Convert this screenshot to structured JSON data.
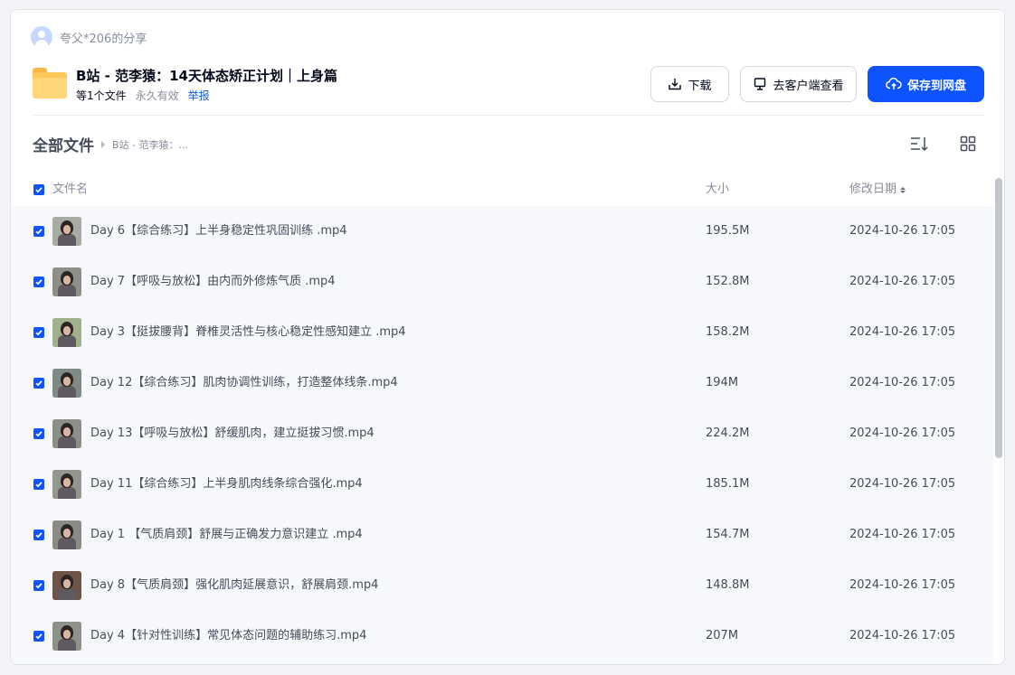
{
  "sharer": {
    "name": "夸父*206的分享"
  },
  "share": {
    "title": "B站 - 范李猿：14天体态矫正计划｜上身篇",
    "file_count": "等1个文件",
    "validity": "永久有效",
    "report_label": "举报"
  },
  "actions": {
    "download_label": "下载",
    "client_label": "去客户端查看",
    "save_label": "保存到网盘"
  },
  "breadcrumb": {
    "root": "全部文件",
    "current": "B站 - 范李猿：..."
  },
  "table": {
    "headers": {
      "name": "文件名",
      "size": "大小",
      "date": "修改日期"
    },
    "rows": [
      {
        "name": "Day 6【综合练习】上半身稳定性巩固训练 .mp4",
        "size": "195.5M",
        "date": "2024-10-26 17:05",
        "checked": true
      },
      {
        "name": "Day 7【呼吸与放松】由内而外修炼气质 .mp4",
        "size": "152.8M",
        "date": "2024-10-26 17:05",
        "checked": true
      },
      {
        "name": "Day 3【挺拔腰背】脊椎灵活性与核心稳定性感知建立 .mp4",
        "size": "158.2M",
        "date": "2024-10-26 17:05",
        "checked": true
      },
      {
        "name": "Day 12【综合练习】肌肉协调性训练，打造整体线条.mp4",
        "size": "194M",
        "date": "2024-10-26 17:05",
        "checked": true
      },
      {
        "name": "Day 13【呼吸与放松】舒缓肌肉，建立挺拔习惯.mp4",
        "size": "224.2M",
        "date": "2024-10-26 17:05",
        "checked": true
      },
      {
        "name": "Day 11【综合练习】上半身肌肉线条综合强化.mp4",
        "size": "185.1M",
        "date": "2024-10-26 17:05",
        "checked": true
      },
      {
        "name": "Day 1 【气质肩颈】舒展与正确发力意识建立 .mp4",
        "size": "154.7M",
        "date": "2024-10-26 17:05",
        "checked": true
      },
      {
        "name": "Day 8【气质肩颈】强化肌肉延展意识，舒展肩颈.mp4",
        "size": "148.8M",
        "date": "2024-10-26 17:05",
        "checked": true
      },
      {
        "name": "Day 4【针对性训练】常见体态问题的辅助练习.mp4",
        "size": "207M",
        "date": "2024-10-26 17:05",
        "checked": true
      }
    ]
  },
  "colors": {
    "primary": "#0d53ff",
    "folder": "#fdc85a",
    "report_link": "#0b59d6"
  },
  "icons": [
    "avatar-icon",
    "folder-icon",
    "download-icon",
    "monitor-icon",
    "cloud-upload-icon",
    "sort-list-icon",
    "grid-view-icon",
    "checkbox-icon",
    "video-thumbnail"
  ]
}
